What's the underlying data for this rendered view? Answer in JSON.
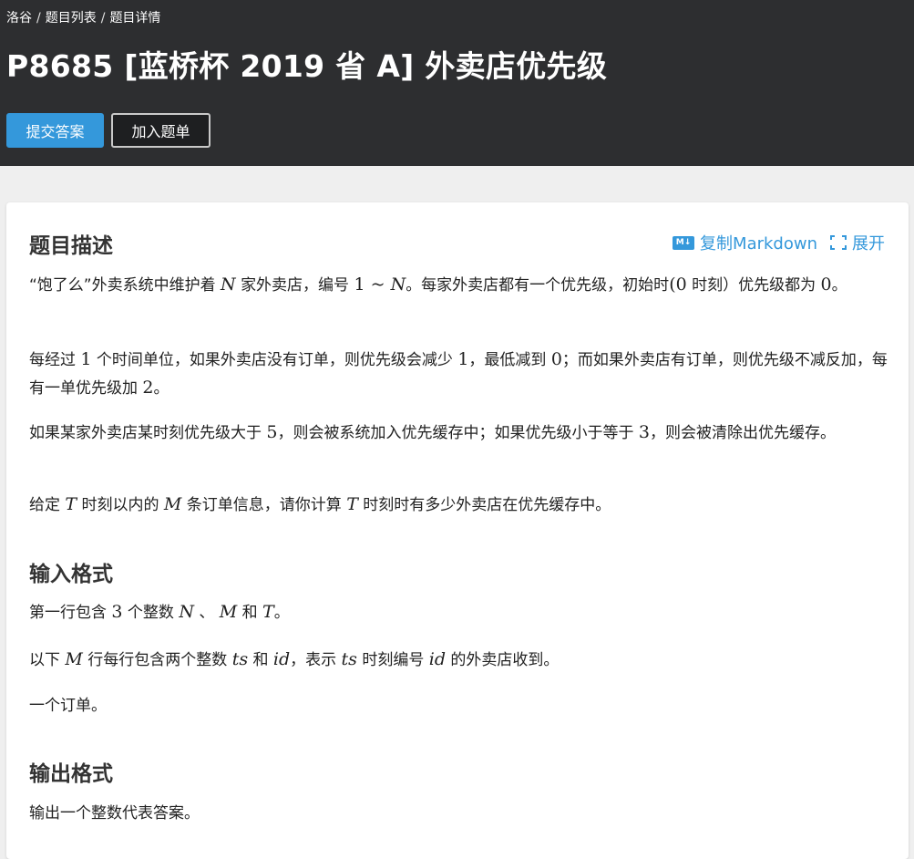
{
  "breadcrumb": {
    "items": [
      "洛谷",
      "题目列表",
      "题目详情"
    ],
    "sep": "/"
  },
  "title": "P8685 [蓝桥杯 2019 省 A] 外卖店优先级",
  "buttons": {
    "submit": "提交答案",
    "add": "加入题单"
  },
  "tools": {
    "md_badge": "M↓",
    "copy_markdown": "复制Markdown",
    "expand": "展开"
  },
  "sections": {
    "description": {
      "title": "题目描述",
      "p1": {
        "a": "“饱了么”外卖系统中维护着",
        "N1": "N",
        "b": "家外卖店，编号",
        "range": "1 ~ ",
        "N2": "N",
        "c": "。每家外卖店都有一个优先级，初始时",
        "paren": "(0",
        "d": "时刻）优先级都为",
        "zero": "0",
        "e": "。"
      },
      "p2": {
        "a": "每经过",
        "one": "1",
        "b": "个时间单位，如果外卖店没有订单，则优先级会减少",
        "one2": "1",
        "c": "，最低减到",
        "zero": "0",
        "d": "；而如果外卖店有订单，则优先级不减反加，每有一单优先级加",
        "two": "2",
        "e": "。"
      },
      "p3": {
        "a": "如果某家外卖店某时刻优先级大于",
        "five": "5",
        "b": "，则会被系统加入优先缓存中；如果优先级小于等于",
        "three": "3",
        "c": "，则会被清除出优先缓存。"
      },
      "p4": {
        "a": "给定",
        "T1": "T",
        "b": "时刻以内的",
        "M": "M",
        "c": "条订单信息，请你计算",
        "T2": "T",
        "d": "时刻时有多少外卖店在优先缓存中。"
      }
    },
    "input": {
      "title": "输入格式",
      "p1": {
        "a": "第一行包含",
        "three": "3",
        "b": "个整数",
        "N": "N",
        "c": "、",
        "M": "M",
        "d": "和",
        "T": "T",
        "e": "。"
      },
      "p2": {
        "a": "以下",
        "M": "M",
        "b": "行每行包含两个整数",
        "ts1": "ts",
        "c": "和",
        "id1": "id",
        "d": "，表示",
        "ts2": "ts",
        "e": "时刻编号",
        "id2": "id",
        "f": "的外卖店收到。"
      },
      "p3": "一个订单。"
    },
    "output": {
      "title": "输出格式",
      "p1": "输出一个整数代表答案。"
    }
  }
}
